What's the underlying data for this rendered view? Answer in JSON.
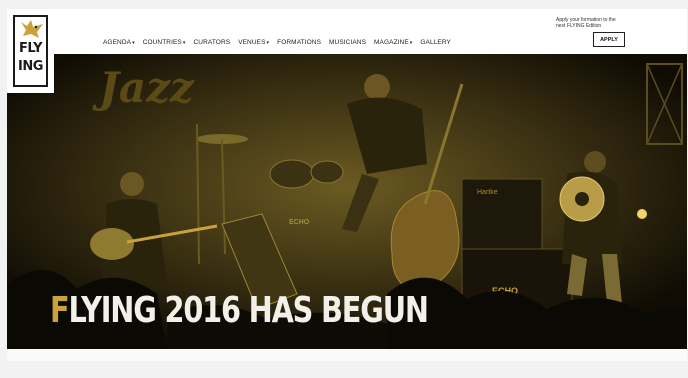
{
  "brand": {
    "logo_line1": "FLY",
    "logo_line2": "ING",
    "accent_color": "#c9a23a"
  },
  "nav": {
    "items": [
      {
        "label": "AGENDA",
        "has_dropdown": true
      },
      {
        "label": "COUNTRIES",
        "has_dropdown": true
      },
      {
        "label": "CURATORS",
        "has_dropdown": false
      },
      {
        "label": "VENUES",
        "has_dropdown": true
      },
      {
        "label": "FORMATIONS",
        "has_dropdown": false
      },
      {
        "label": "MUSICIANS",
        "has_dropdown": false
      },
      {
        "label": "MAGAZINE",
        "has_dropdown": true
      },
      {
        "label": "GALLERY",
        "has_dropdown": false
      }
    ]
  },
  "apply": {
    "prompt": "Apply your formation to the next FLYING Edition",
    "button_label": "APPLY"
  },
  "hero": {
    "headline_first": "F",
    "headline_rest": "LYING 2016 HAS BEGUN",
    "sign_text": "Jazz",
    "amp_label_1": "ECHO",
    "amp_label_2": "ECHO",
    "amp_label_3": "Hartke"
  }
}
